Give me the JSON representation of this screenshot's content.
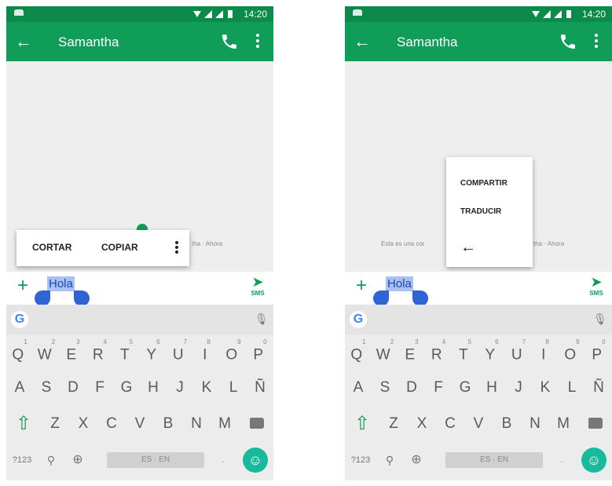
{
  "status_bar": {
    "time": "14:20"
  },
  "app_bar": {
    "title": "Samantha",
    "back_icon": "arrow-left-icon",
    "call_icon": "phone-icon",
    "more_icon": "more-vert-icon"
  },
  "compose": {
    "selected_text": "Hola",
    "send_label": "SMS",
    "send_icon": "send-icon"
  },
  "screens": [
    {
      "menu": {
        "cut": "CORTAR",
        "copy": "COPIAR",
        "overflow_icon": "more-vert-icon"
      },
      "timestamp": "tha · Ahora"
    },
    {
      "menu": {
        "share": "COMPARTIR",
        "translate": "TRADUCIR",
        "back_icon": "arrow-left-icon"
      },
      "bubble_preview": "Esta es una cor",
      "timestamp": "tha · Ahora"
    }
  ],
  "keyboard": {
    "row1": [
      "Q",
      "W",
      "E",
      "R",
      "T",
      "Y",
      "U",
      "I",
      "O",
      "P"
    ],
    "row1_hints": [
      "1",
      "2",
      "3",
      "4",
      "5",
      "6",
      "7",
      "8",
      "9",
      "0"
    ],
    "row2": [
      "A",
      "S",
      "D",
      "F",
      "G",
      "H",
      "J",
      "K",
      "L",
      "Ñ"
    ],
    "row3": [
      "Z",
      "X",
      "C",
      "V",
      "B",
      "N",
      "M"
    ],
    "symbols_label": "?123",
    "space_label": "ES · EN",
    "period_label": ".",
    "accent_color": "#0f9d58",
    "emoji_color": "#18b99c"
  },
  "colors": {
    "status_bar": "#0b8a4a",
    "app_bar": "#0f9d58",
    "selection": "#a9c1f3",
    "handle": "#2f63d6"
  }
}
